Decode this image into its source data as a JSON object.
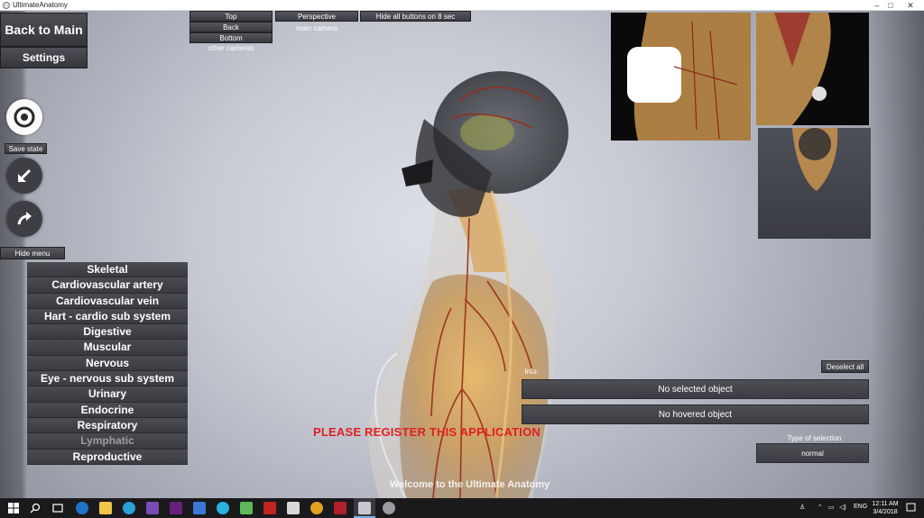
{
  "window": {
    "title": "UltimateAnatomy",
    "controls": [
      "–",
      "□",
      "✕"
    ]
  },
  "left_panel": {
    "back_to_main": "Back to Main",
    "settings": "Settings",
    "save_state": "Save state",
    "hide_menu": "Hide menu"
  },
  "camera_controls": {
    "top": "Top",
    "back": "Back",
    "bottom": "Bottom",
    "other_cameras": "other cameras",
    "perspective": "Perspective",
    "main_camera": "main camera",
    "hide_all_buttons": "Hide all buttons on 8 sec"
  },
  "systems": [
    {
      "label": "Skeletal",
      "enabled": true
    },
    {
      "label": "Cardiovascular artery",
      "enabled": true
    },
    {
      "label": "Cardiovascular vein",
      "enabled": true
    },
    {
      "label": "Hart - cardio sub system",
      "enabled": true
    },
    {
      "label": "Digestive",
      "enabled": true
    },
    {
      "label": "Muscular",
      "enabled": true
    },
    {
      "label": "Nervous",
      "enabled": true
    },
    {
      "label": "Eye - nervous sub system",
      "enabled": true
    },
    {
      "label": "Urinary",
      "enabled": true
    },
    {
      "label": "Endocrine",
      "enabled": true
    },
    {
      "label": "Respiratory",
      "enabled": true
    },
    {
      "label": "Lymphatic",
      "enabled": false
    },
    {
      "label": "Reproductive",
      "enabled": true
    }
  ],
  "info_panel": {
    "deselect_all": "Deselect all",
    "info_label": "Info:",
    "selected": "No selected object",
    "hovered": "No hovered object",
    "type_of_selection_label": "Type of selection",
    "type_of_selection_value": "normal"
  },
  "register_notice": "PLEASE REGISTER THIS APPLICATION",
  "welcome": "Welcome to the Ultimate Anatomy",
  "taskbar": {
    "language": "ENG",
    "time": "12:11 AM",
    "date": "3/4/2018"
  },
  "colors": {
    "register_red": "#e02020",
    "button_dark": "#3e3f44",
    "anatomy_tan": "#d9a860",
    "artery_red": "#9a2a1a"
  }
}
